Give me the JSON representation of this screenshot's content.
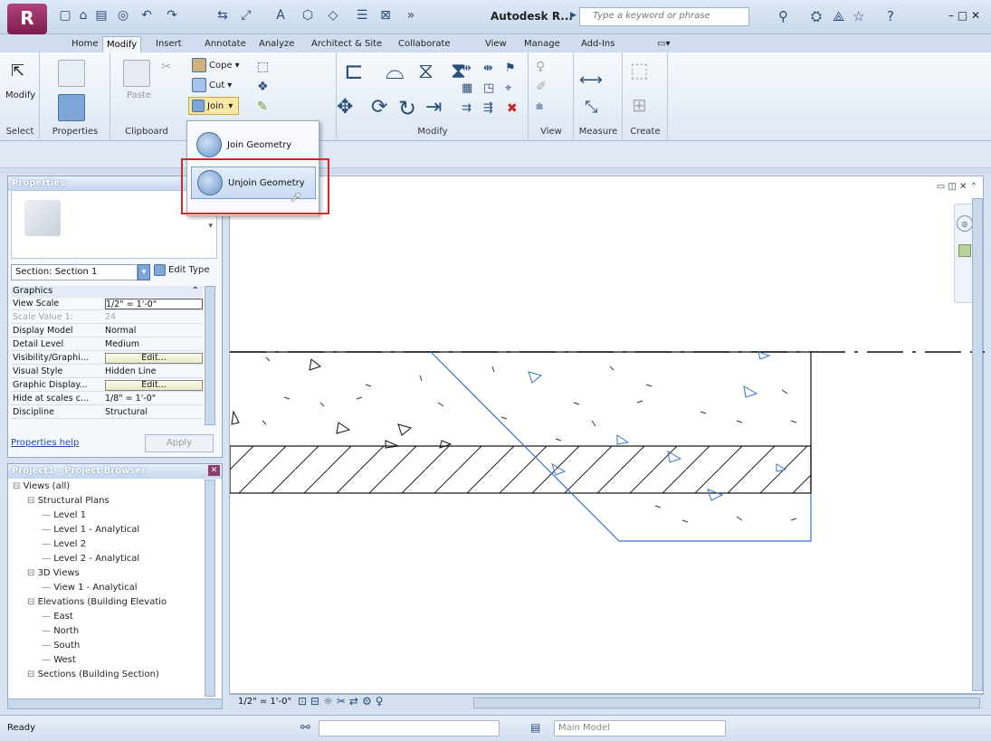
{
  "window": {
    "app_title": "Autodesk R...",
    "search_placeholder": "Type a keyword or phrase",
    "controls": "– □ ✕"
  },
  "app_button": {
    "letter": "R"
  },
  "ribbon_tabs": [
    "Home",
    "Modify",
    "Insert",
    "Annotate",
    "Analyze",
    "Architect & Site",
    "Collaborate",
    "View",
    "Manage",
    "Add-Ins"
  ],
  "active_tab": "Modify",
  "panels": {
    "select": "Select",
    "properties": "Properties",
    "clipboard": "Clipboard",
    "modify": "Modify",
    "view": "View",
    "measure": "Measure",
    "create": "Create"
  },
  "buttons": {
    "modify": "Modify",
    "paste": "Paste",
    "cope": "Cope",
    "cut": "Cut",
    "join": "Join"
  },
  "join_menu": {
    "items": [
      "Join Geometry",
      "Unjoin Geometry"
    ],
    "selected_index": 1
  },
  "properties": {
    "header": "Properties",
    "type_selector": "Section: Section 1",
    "edit_type": "Edit Type",
    "group": "Graphics",
    "rows": [
      {
        "k": "View Scale",
        "v": "1/2\" = 1'-0\""
      },
      {
        "k": "Scale Value    1:",
        "v": "24",
        "disabled": true
      },
      {
        "k": "Display Model",
        "v": "Normal"
      },
      {
        "k": "Detail Level",
        "v": "Medium"
      },
      {
        "k": "Visibility/Graphi...",
        "v": "Edit...",
        "button": true
      },
      {
        "k": "Visual Style",
        "v": "Hidden Line"
      },
      {
        "k": "Graphic Display...",
        "v": "Edit...",
        "button": true
      },
      {
        "k": "Hide at scales c...",
        "v": "1/8\" = 1'-0\""
      },
      {
        "k": "Discipline",
        "v": "Structural"
      }
    ],
    "help_link": "Properties help",
    "apply": "Apply"
  },
  "browser": {
    "header": "Project1 - Project Browser",
    "nodes": [
      {
        "t": "Views (all)",
        "d": 0
      },
      {
        "t": "Structural Plans",
        "d": 1
      },
      {
        "t": "Level 1",
        "d": 2
      },
      {
        "t": "Level 1 - Analytical",
        "d": 2
      },
      {
        "t": "Level 2",
        "d": 2
      },
      {
        "t": "Level 2 - Analytical",
        "d": 2
      },
      {
        "t": "3D Views",
        "d": 1
      },
      {
        "t": "View 1 - Analytical",
        "d": 2
      },
      {
        "t": "Elevations (Building Elevatio",
        "d": 1
      },
      {
        "t": "East",
        "d": 2
      },
      {
        "t": "North",
        "d": 2
      },
      {
        "t": "South",
        "d": 2
      },
      {
        "t": "West",
        "d": 2
      },
      {
        "t": "Sections (Building Section)",
        "d": 1
      }
    ]
  },
  "view_bar": {
    "scale": "1/2\" = 1'-0\""
  },
  "status": {
    "text": "Ready",
    "model": "Main Model"
  }
}
